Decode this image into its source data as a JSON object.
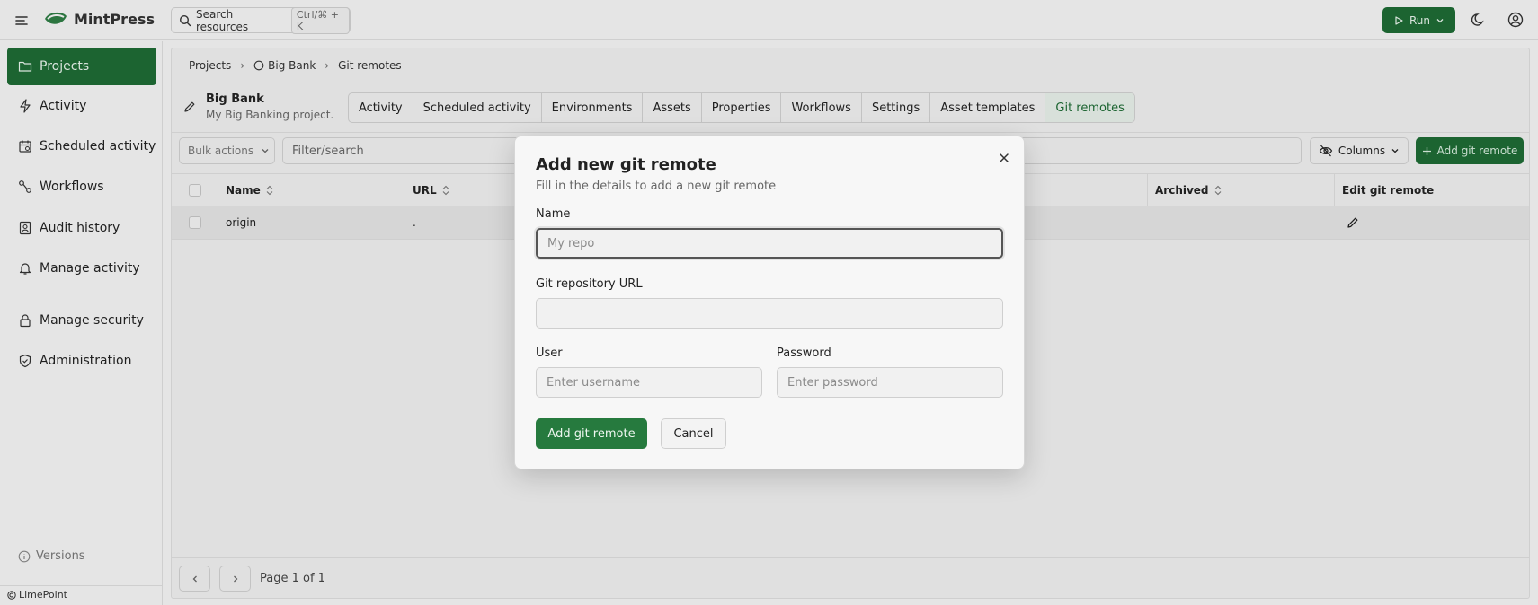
{
  "app": {
    "name": "MintPress"
  },
  "topbar": {
    "search_label": "Search resources",
    "search_shortcut": "Ctrl/⌘ + K",
    "run_label": "Run"
  },
  "sidebar": {
    "items": [
      {
        "label": "Projects",
        "icon": "folder-icon",
        "active": true
      },
      {
        "label": "Activity",
        "icon": "lightning-icon"
      },
      {
        "label": "Scheduled activity",
        "icon": "calendar-icon"
      },
      {
        "label": "Workflows",
        "icon": "workflow-icon"
      },
      {
        "label": "Audit history",
        "icon": "audit-icon"
      },
      {
        "label": "Manage activity",
        "icon": "bell-icon"
      },
      {
        "label": "Manage security",
        "icon": "lock-icon"
      },
      {
        "label": "Administration",
        "icon": "shield-icon"
      }
    ],
    "versions_label": "Versions",
    "footer_brand": "LimePoint"
  },
  "breadcrumb": [
    "Projects",
    "Big Bank",
    "Git remotes"
  ],
  "project": {
    "name": "Big Bank",
    "description": "My Big Banking project."
  },
  "tabs": [
    {
      "label": "Activity"
    },
    {
      "label": "Scheduled activity"
    },
    {
      "label": "Environments"
    },
    {
      "label": "Assets"
    },
    {
      "label": "Properties"
    },
    {
      "label": "Workflows"
    },
    {
      "label": "Settings"
    },
    {
      "label": "Asset templates"
    },
    {
      "label": "Git remotes",
      "active": true
    }
  ],
  "toolbar": {
    "bulk_actions": "Bulk actions",
    "filter_placeholder": "Filter/search",
    "columns_label": "Columns",
    "add_label": "Add git remote"
  },
  "table": {
    "columns": [
      "Name",
      "URL",
      "Archived",
      "Edit git remote"
    ],
    "rows": [
      {
        "name": "origin",
        "url": "."
      }
    ]
  },
  "pagination": {
    "label": "Page 1 of 1"
  },
  "modal": {
    "title": "Add new git remote",
    "subtitle": "Fill in the details to add a new git remote",
    "name_label": "Name",
    "name_placeholder": "My repo",
    "url_label": "Git repository URL",
    "url_value": "",
    "user_label": "User",
    "user_placeholder": "Enter username",
    "password_label": "Password",
    "password_placeholder": "Enter password",
    "submit_label": "Add git remote",
    "cancel_label": "Cancel"
  },
  "colors": {
    "brand_green": "#1e6b35",
    "button_green": "#267a3e"
  }
}
